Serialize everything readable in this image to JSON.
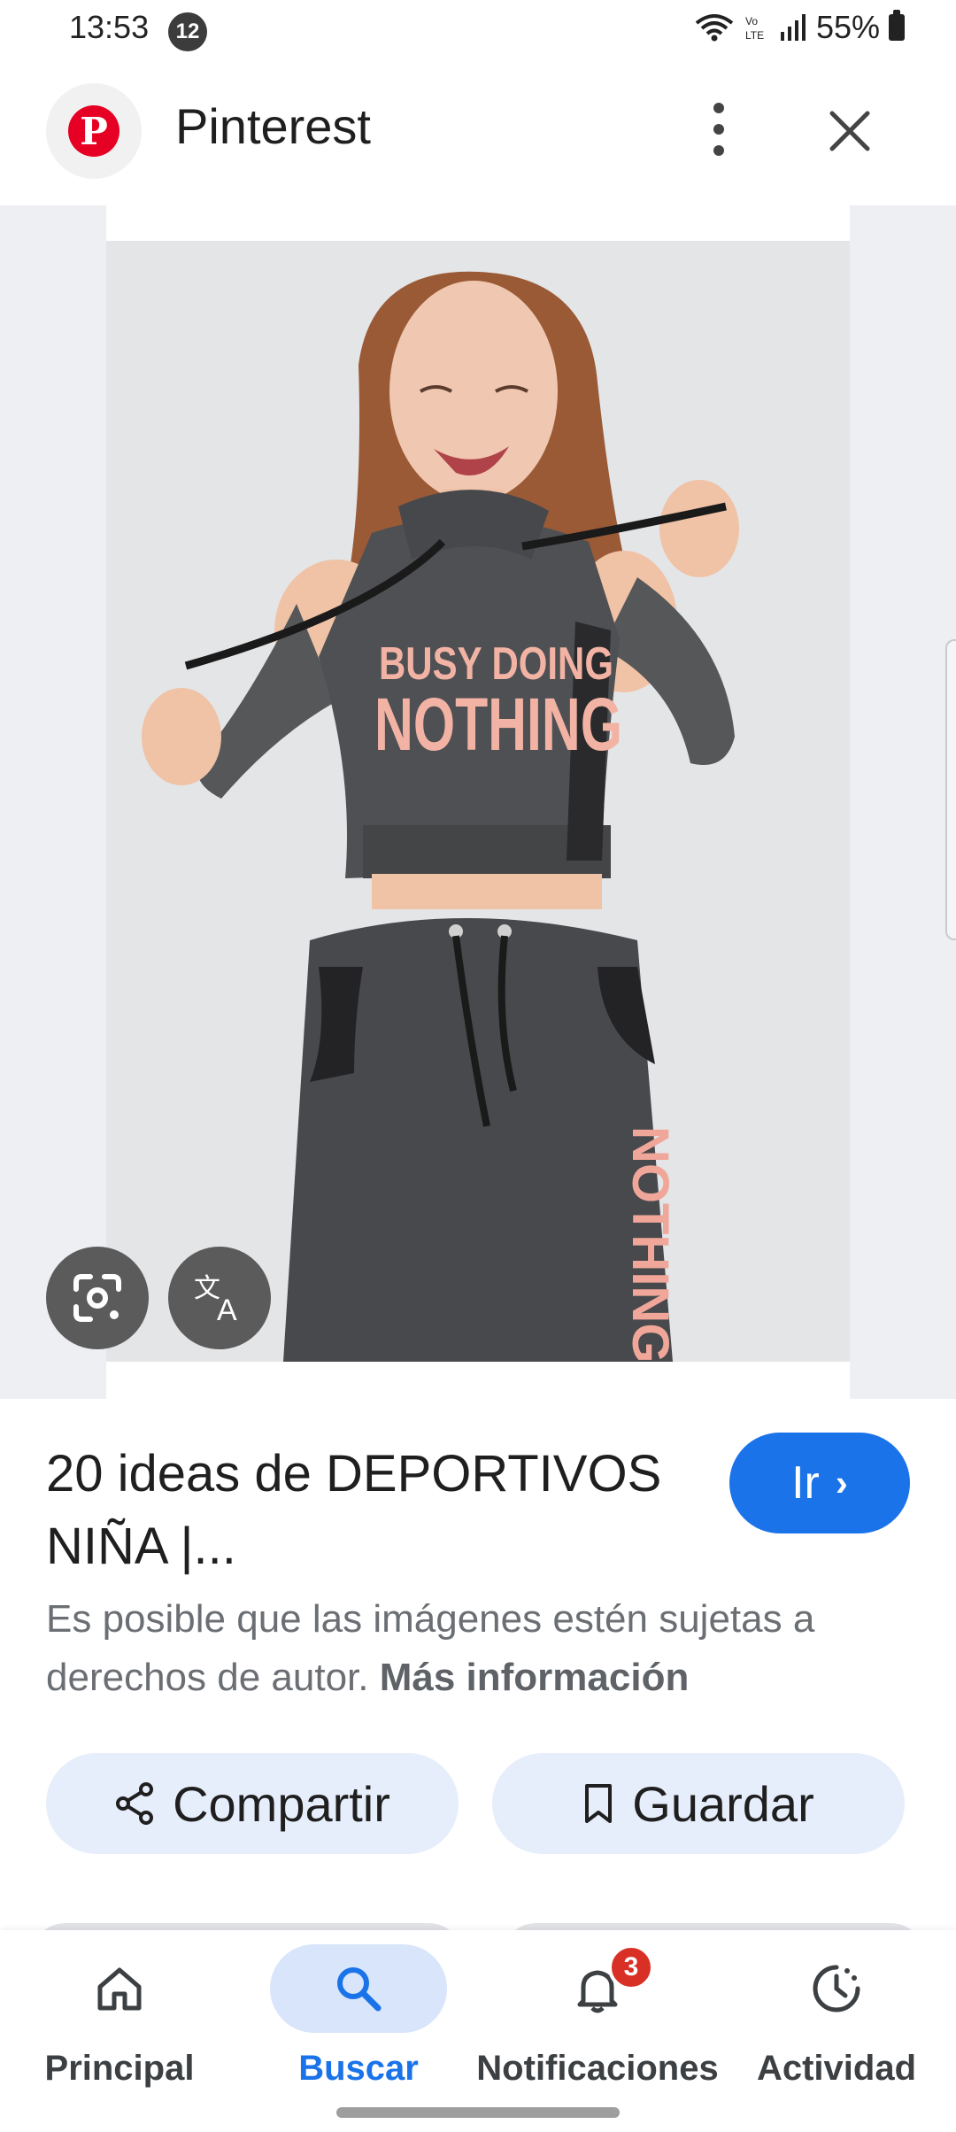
{
  "status_bar": {
    "time": "13:53",
    "notification_count": "12",
    "battery": "55%"
  },
  "header": {
    "app_title": "Pinterest",
    "logo_icon": "pinterest-logo"
  },
  "image": {
    "shirt_text_line1": "BUSY DOING",
    "shirt_text_line2": "NOTHING",
    "pants_text": "NOTHING",
    "lens_button_icon": "lens-icon",
    "translate_button_icon": "translate-icon"
  },
  "result": {
    "title": "20 ideas de DEPORTIVOS NIÑA |...",
    "go_label": "Ir",
    "go_arrow": "›",
    "copyright_text": "Es posible que las imágenes estén sujetas a derechos de autor. ",
    "more_info_label": "Más información"
  },
  "actions": {
    "share_label": "Compartir",
    "save_label": "Guardar"
  },
  "bottom_nav": {
    "items": [
      {
        "label": "Principal",
        "icon": "home-icon"
      },
      {
        "label": "Buscar",
        "icon": "search-icon",
        "active": true
      },
      {
        "label": "Notificaciones",
        "icon": "bell-icon",
        "badge": "3"
      },
      {
        "label": "Actividad",
        "icon": "activity-icon"
      }
    ]
  },
  "colors": {
    "accent": "#1a73e8",
    "pinterest_red": "#e60023",
    "badge_red": "#d93025"
  }
}
